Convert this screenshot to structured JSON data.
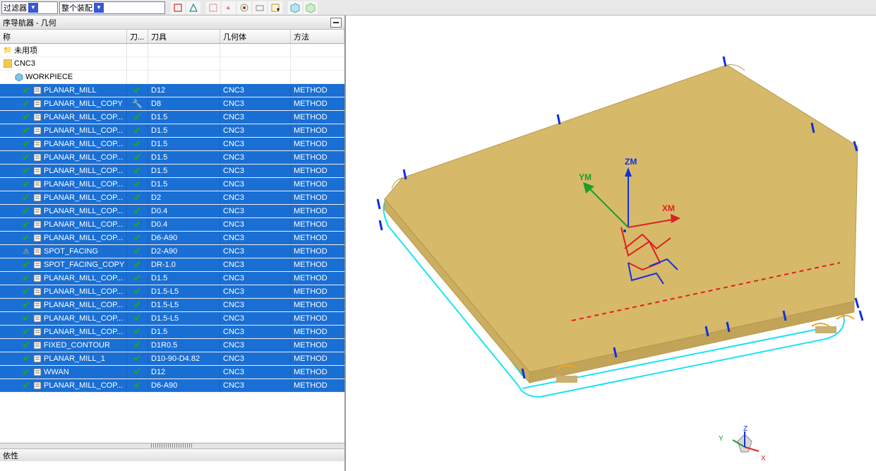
{
  "toolbar": {
    "combo1": "过滤器",
    "combo2": "整个装配"
  },
  "navigator": {
    "title": "序导航器 - 几何",
    "columns": {
      "name": "称",
      "check": "刀...",
      "tool": "刀具",
      "geom": "几何体",
      "method": "方法"
    },
    "root_unused": "未用项",
    "program_node": "CNC3",
    "workpiece_node": "WORKPIECE",
    "dep_title": "依性"
  },
  "operations": [
    {
      "name": "PLANAR_MILL",
      "chk": "green",
      "tool": "D12",
      "geom": "CNC3",
      "method": "METHOD"
    },
    {
      "name": "PLANAR_MILL_COPY",
      "chk": "wrench",
      "tool": "D8",
      "geom": "CNC3",
      "method": "METHOD"
    },
    {
      "name": "PLANAR_MILL_COP...",
      "chk": "green",
      "tool": "D1.5",
      "geom": "CNC3",
      "method": "METHOD"
    },
    {
      "name": "PLANAR_MILL_COP...",
      "chk": "green",
      "tool": "D1.5",
      "geom": "CNC3",
      "method": "METHOD"
    },
    {
      "name": "PLANAR_MILL_COP...",
      "chk": "green",
      "tool": "D1.5",
      "geom": "CNC3",
      "method": "METHOD"
    },
    {
      "name": "PLANAR_MILL_COP...",
      "chk": "green",
      "tool": "D1.5",
      "geom": "CNC3",
      "method": "METHOD"
    },
    {
      "name": "PLANAR_MILL_COP...",
      "chk": "green",
      "tool": "D1.5",
      "geom": "CNC3",
      "method": "METHOD"
    },
    {
      "name": "PLANAR_MILL_COP...",
      "chk": "green",
      "tool": "D1.5",
      "geom": "CNC3",
      "method": "METHOD"
    },
    {
      "name": "PLANAR_MILL_COP...",
      "chk": "green",
      "tool": "D2",
      "geom": "CNC3",
      "method": "METHOD"
    },
    {
      "name": "PLANAR_MILL_COP...",
      "chk": "green",
      "tool": "D0.4",
      "geom": "CNC3",
      "method": "METHOD"
    },
    {
      "name": "PLANAR_MILL_COP...",
      "chk": "green",
      "tool": "D0.4",
      "geom": "CNC3",
      "method": "METHOD"
    },
    {
      "name": "PLANAR_MILL_COP...",
      "chk": "green",
      "tool": "D6-A90",
      "geom": "CNC3",
      "method": "METHOD"
    },
    {
      "name": "SPOT_FACING",
      "chk": "green",
      "tool": "D2-A90",
      "geom": "CNC3",
      "method": "METHOD",
      "warn": true
    },
    {
      "name": "SPOT_FACING_COPY",
      "chk": "green",
      "tool": "DR-1.0",
      "geom": "CNC3",
      "method": "METHOD"
    },
    {
      "name": "PLANAR_MILL_COP...",
      "chk": "green",
      "tool": "D1.5",
      "geom": "CNC3",
      "method": "METHOD"
    },
    {
      "name": "PLANAR_MILL_COP...",
      "chk": "green",
      "tool": "D1.5-L5",
      "geom": "CNC3",
      "method": "METHOD"
    },
    {
      "name": "PLANAR_MILL_COP...",
      "chk": "green",
      "tool": "D1.5-L5",
      "geom": "CNC3",
      "method": "METHOD"
    },
    {
      "name": "PLANAR_MILL_COP...",
      "chk": "green",
      "tool": "D1.5-L5",
      "geom": "CNC3",
      "method": "METHOD"
    },
    {
      "name": "PLANAR_MILL_COP...",
      "chk": "green",
      "tool": "D1.5",
      "geom": "CNC3",
      "method": "METHOD"
    },
    {
      "name": "FIXED_CONTOUR",
      "chk": "green",
      "tool": "D1R0.5",
      "geom": "CNC3",
      "method": "METHOD"
    },
    {
      "name": "PLANAR_MILL_1",
      "chk": "green",
      "tool": "D10-90-D4.82",
      "geom": "CNC3",
      "method": "METHOD"
    },
    {
      "name": "WWAN",
      "chk": "green",
      "tool": "D12",
      "geom": "CNC3",
      "method": "METHOD"
    },
    {
      "name": "PLANAR_MILL_COP...",
      "chk": "green",
      "tool": "D6-A90",
      "geom": "CNC3",
      "method": "METHOD"
    }
  ],
  "viewport": {
    "axes": {
      "x": "XM",
      "y": "YM",
      "z": "ZM"
    },
    "triad": {
      "x": "X",
      "y": "Y",
      "z": "Z"
    }
  }
}
